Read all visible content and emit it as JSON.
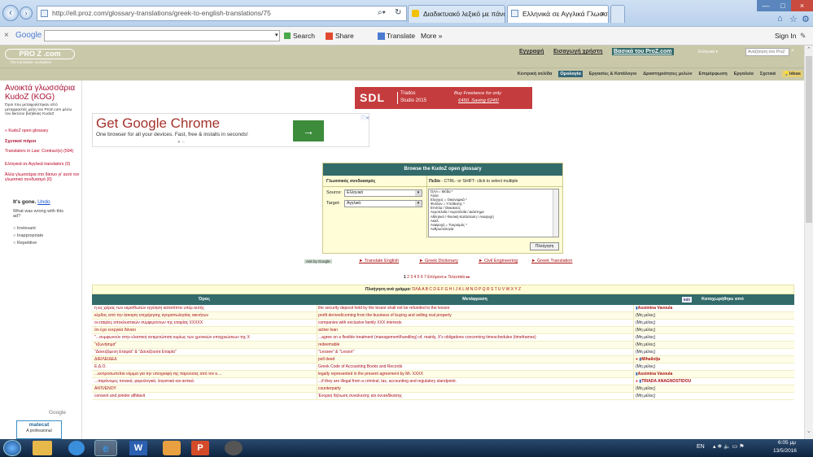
{
  "browser": {
    "address": "http://ell.proz.com/glossary-translations/greek-to-english-translations/75",
    "address_host": "ell.proz.com",
    "tabs": [
      {
        "label": "Διαδικτυακό λεξικό με πάνω α...",
        "active": false
      },
      {
        "label": "Ελληνικά σε Αγγλικά Γλωσσ...",
        "active": true
      }
    ]
  },
  "googlebar": {
    "close": "×",
    "brand": "Google",
    "search": "Search",
    "share": "Share",
    "translate": "Translate",
    "more": "More »",
    "signin": "Sign In"
  },
  "site": {
    "logo_text": "PRO Z .com",
    "tagline": "The translation workplace",
    "links": [
      "Εγγραφή",
      "Εισαγωγή χρήστη"
    ],
    "basic_link": "Βασικά του ProZ.com",
    "lang_select": "Ελληνικά",
    "search_placeholder": "Αναζήτηση στο ProZ",
    "nav": [
      "Κεντρική σελίδα",
      "Ορολογία",
      "Εργασίες & Κατάλογοι",
      "Δραστηριότητες μελών",
      "Επιμόρφωση",
      "Εργαλεία",
      "Σχετικά",
      "Ideas"
    ],
    "nav_active": "Ορολογία"
  },
  "sidebar": {
    "title": "Ανοικτά γλωσσάρια KudoZ (KOG)",
    "desc": "Όροι που μεταφράστηκαν από μεταφραστές μέλη του ProZ.com μέσω του δικτύου βοήθειας KudoZ",
    "kudoz_link": "« KudoZ open glossary",
    "related_head": "Σχετικοί πόροι",
    "related": [
      "Translators in Law: Contract(s) (594)",
      "Ελληνικά σε Αγγλικά translators (0)",
      "Άλλα γλωσσάρια στο δίκτυο γι' αυτό τον γλωσσικό συνδυασμό (0)"
    ],
    "ad_gone": "It's gone.",
    "ad_undo": "Undo",
    "ad_question": "What was wrong with this ad?",
    "ad_options": [
      "Irrelevant",
      "Inappropriate",
      "Repetitive"
    ],
    "google_label": "Google",
    "matecat_label": "matecat",
    "matecat_sub": "A professional"
  },
  "banner": {
    "brand": "SDL",
    "product_line1": "Trados",
    "product_line2": "Studio 2015",
    "offer_line1": "Buy Freelance for only",
    "offer_line2": "€450. Saving €245!"
  },
  "google_ad": {
    "headline": "Get Google Chrome",
    "body": "One browser for all your devices. Fast, free & installs in seconds!",
    "arrow": "→"
  },
  "glossary_browse": {
    "header": "Browse the KudoZ open glossary",
    "pair_label": "Γλωσσικός συνδυασμός",
    "field_label": "Πεδίο",
    "field_hint": "- CTRL- or SHIFT- click to select multiple",
    "source_label": "Source:",
    "source_value": "Ελληνικά",
    "target_label": "Target:",
    "target_value": "Αγγλικά",
    "fields": [
      "ΌΛΑ = Μόδα *",
      "Άλλα",
      "Ελεγχος = Οικονομικά *",
      "Φυλλον = Υπόθεσης *",
      "Επιπλα / Οικιακούς",
      "Αεροπλοΐα / Αεροπλοΐα / Διάστημα",
      "Αθλητικό / Φυσική Κατάσταση / Αναψυχή",
      "Ακαλ",
      "Αναψυχή = Τουρισμός *",
      "Ανθρωπολογία"
    ],
    "submit": "Πλοήγηση"
  },
  "adlinks": {
    "badge": "Ads by Google",
    "links": [
      "► Translate English",
      "► Greek Dictionary",
      "► Civil Engineering",
      "► Greek Translation"
    ]
  },
  "pagination": {
    "current": "1",
    "pages": "2 3 4 5 6 7",
    "next": "Επόμενο ▸",
    "last": "Τελευταίο ▸▸"
  },
  "alpha_nav": {
    "label": "Πλοήγηση ανά γράμμα:",
    "letters": "ΌΛΑ A B C D E F G H I J K L M N O P Q R S T U V W X Y Z"
  },
  "table": {
    "headers": [
      "Όρος",
      "Μετάφραση",
      "Καταχωρήθηκε από"
    ],
    "edit_badge": "Edit",
    "rows": [
      {
        "term": "η εις χείρας των εκμισθωτών εγγύηση καταπίπτει υπέρ αυτής",
        "translation": "the security deposit held by the lessor shall not be refunded to the lessee",
        "by": "Assimina Vavoula",
        "icon": false
      },
      {
        "term": "κέρδος από την άσκηση επιχείρησης αγοραπωλησίας ακινήτων",
        "translation": "profit derived/coming from the business of buying and selling real property",
        "by": "(Μη μέλος)",
        "icon": false
      },
      {
        "term": "οι εταιρίες αποκλειστικών συμφερόντων της εταιρίας XXXXX",
        "translation": "companies with exclusive family XXX interests",
        "by": "(Μη μέλος)",
        "icon": false
      },
      {
        "term": "ότι έχει ενεργεία δάνειο",
        "translation": "active loan",
        "by": "(Μη μέλος)",
        "icon": false
      },
      {
        "term": "\"...συμφωνούν στην ελαστική αντιμετώπιση κυρίως των χρονικών υποχρεώσεων της X",
        "translation": "...agree on a flexible treatment (management/handling) of, mainly, X's obligations concerning timeschedules (timeframes)",
        "by": "(Μη μέλος)",
        "icon": false
      },
      {
        "term": "\"εξωνήσιμα\"",
        "translation": "redeemable",
        "by": "(Μη μέλος)",
        "icon": false
      },
      {
        "term": "\"Δανειζόμενη Εταιρία\" & \"Δανείζουσα Εταιρία\"",
        "translation": "\"Lessee\" & \"Lessor\"",
        "by": "(Μη μέλος)",
        "icon": false
      },
      {
        "term": "ΔΙΕΙΛΕΙΔΕΔ",
        "translation": "poll deed",
        "by": "Mihailolja",
        "icon": true
      },
      {
        "term": "Ε.Δ.Ο.",
        "translation": "Greek Code of Accounting Books and Records",
        "by": "(Μη μέλος)",
        "icon": false
      },
      {
        "term": "...εκπροσωπείται νόμιμα για την υπογραφή της παρούσας από τον κ....",
        "translation": "legally represented in the present agreement by Mr. XXXX",
        "by": "Assimina Vavoula",
        "icon": false
      },
      {
        "term": "...παράνομες ποινικά, φορολογικά, λογιστικά και αστικά.",
        "translation": "...if they are illegal from a criminal, tax, accounting and regulatory standpoint.",
        "by": "TRIADA ANAGNOSTIDOU",
        "icon": true
      },
      {
        "term": "ΑΝΤΙ/ΕΝΟΥ",
        "translation": "counterparty",
        "by": "(Μη μέλος)",
        "icon": false
      },
      {
        "term": "consent and joinder affidavit",
        "translation": "Ένορκη δήλωση συναίνεσης και συνεκδίκασης",
        "by": "(Μη μέλος)",
        "icon": false
      }
    ]
  },
  "taskbar": {
    "lang": "EN",
    "time": "6:05 μμ",
    "date": "13/5/2016"
  }
}
